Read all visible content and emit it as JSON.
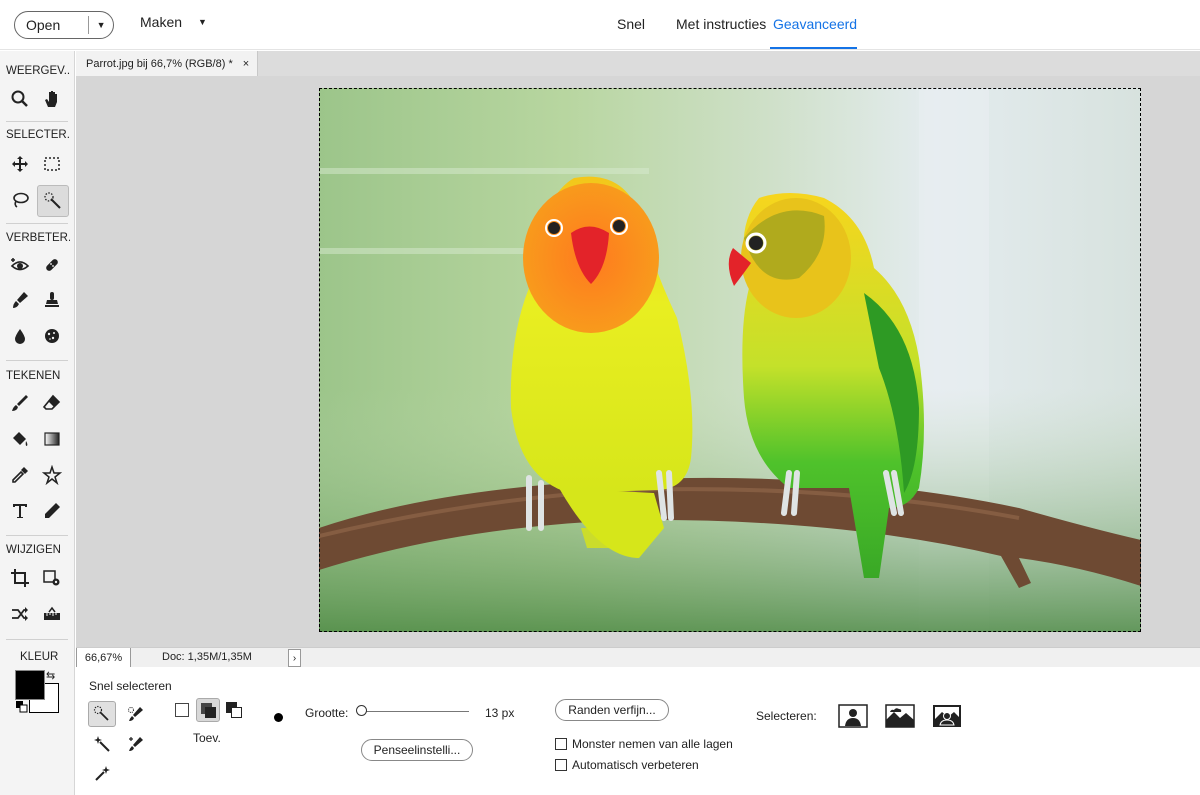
{
  "topbar": {
    "open_label": "Open",
    "make_label": "Maken",
    "modes": [
      "Snel",
      "Met instructies",
      "Geavanceerd"
    ],
    "active_mode": "Geavanceerd"
  },
  "toolbox": {
    "sections": {
      "view": "WEERGEV...",
      "select": "SELECTER...",
      "enhance": "VERBETER...",
      "draw": "TEKENEN",
      "modify": "WIJZIGEN",
      "color": "KLEUR"
    },
    "tools": [
      "zoom-icon",
      "hand-icon",
      "move-icon",
      "marquee-icon",
      "lasso-icon",
      "quick-selection-icon",
      "red-eye-icon",
      "spot-healing-icon",
      "smart-brush-icon",
      "clone-stamp-icon",
      "blur-icon",
      "sponge-icon",
      "brush-icon",
      "eraser-icon",
      "paint-bucket-icon",
      "gradient-icon",
      "eyedropper-icon",
      "custom-shape-icon",
      "type-icon",
      "pencil-icon",
      "crop-icon",
      "recompose-icon",
      "content-aware-move-icon",
      "straighten-icon"
    ],
    "foreground_color": "#000000",
    "background_color": "#ffffff"
  },
  "document": {
    "tab_title": "Parrot.jpg bij 66,7% (RGB/8) *",
    "close_glyph": "×"
  },
  "status": {
    "zoom": "66,67%",
    "doc_size": "Doc: 1,35M/1,35M",
    "arrow": "›"
  },
  "options": {
    "title": "Snel selecteren",
    "mode_label": "Toev.",
    "size_label": "Grootte:",
    "size_value": "13 px",
    "size_slider_fraction": 0.04,
    "brush_settings_label": "Penseelinstelli...",
    "refine_edge_label": "Randen verfijn...",
    "sample_all_label": "Monster nemen van alle lagen",
    "sample_all_checked": false,
    "auto_enhance_label": "Automatisch verbeteren",
    "auto_enhance_checked": false,
    "select_label": "Selecteren:",
    "select_buttons": [
      "subject-icon",
      "sky-icon",
      "background-icon"
    ]
  }
}
